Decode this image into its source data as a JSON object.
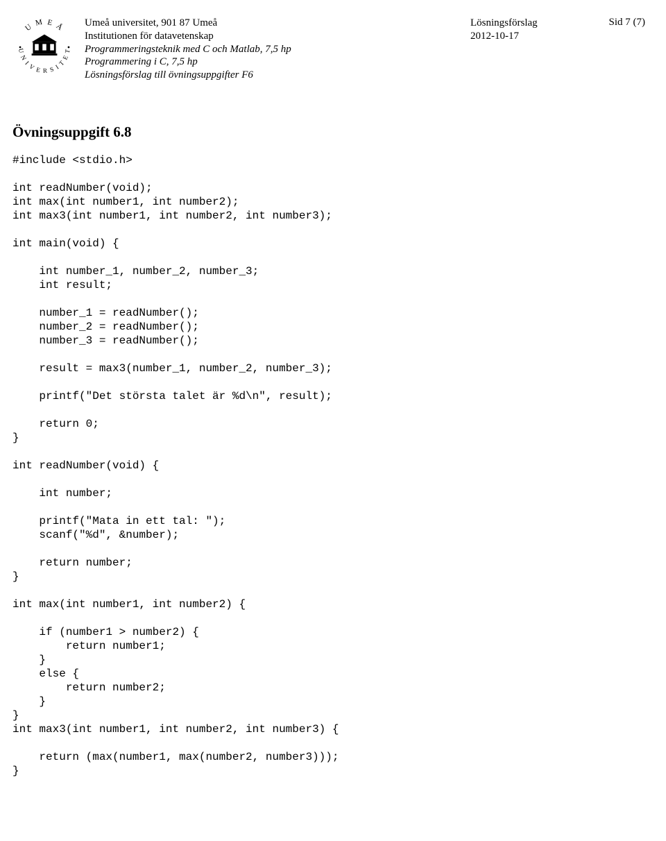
{
  "header": {
    "university": "Umeå universitet, 901 87 Umeå",
    "institution": "Institutionen för datavetenskap",
    "course1": "Programmeringsteknik med C och Matlab, 7,5 hp",
    "course2": "Programmering i C, 7,5 hp",
    "subtitle": "Lösningsförslag till övningsuppgifter F6",
    "doc_type": "Lösningsförslag",
    "date": "2012-10-17",
    "page": "Sid 7 (7)"
  },
  "exercise": {
    "title": "Övningsuppgift 6.8",
    "code": "#include <stdio.h>\n\nint readNumber(void);\nint max(int number1, int number2);\nint max3(int number1, int number2, int number3);\n\nint main(void) {\n\n    int number_1, number_2, number_3;\n    int result;\n\n    number_1 = readNumber();\n    number_2 = readNumber();\n    number_3 = readNumber();\n\n    result = max3(number_1, number_2, number_3);\n\n    printf(\"Det största talet är %d\\n\", result);\n\n    return 0;\n}\n\nint readNumber(void) {\n\n    int number;\n\n    printf(\"Mata in ett tal: \");\n    scanf(\"%d\", &number);\n\n    return number;\n}\n\nint max(int number1, int number2) {\n\n    if (number1 > number2) {\n        return number1;\n    }\n    else {\n        return number2;\n    }\n}\nint max3(int number1, int number2, int number3) {\n\n    return (max(number1, max(number2, number3)));\n}"
  }
}
